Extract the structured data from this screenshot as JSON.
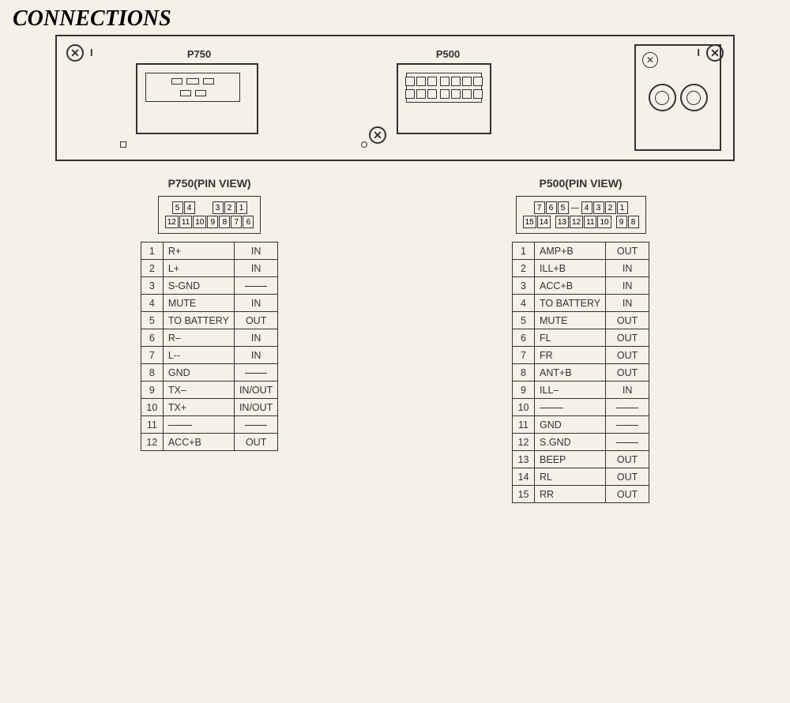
{
  "title": "CONNECTIONS",
  "connectors": {
    "p750": {
      "label": "P750",
      "pinView": {
        "title": "P750(PIN VIEW)",
        "row1": [
          "5",
          "4",
          "",
          "3",
          "2",
          "1"
        ],
        "row2": [
          "12",
          "11",
          "10",
          "9",
          "8",
          "7",
          "6"
        ]
      },
      "pins": [
        {
          "num": "1",
          "name": "R+",
          "dir": "IN"
        },
        {
          "num": "2",
          "name": "L+",
          "dir": "IN"
        },
        {
          "num": "3",
          "name": "S-GND",
          "dir": "—"
        },
        {
          "num": "4",
          "name": "MUTE",
          "dir": "IN"
        },
        {
          "num": "5",
          "name": "TO BATTERY",
          "dir": "OUT"
        },
        {
          "num": "6",
          "name": "R–",
          "dir": "IN"
        },
        {
          "num": "7",
          "name": "L--",
          "dir": "IN"
        },
        {
          "num": "8",
          "name": "GND",
          "dir": "—"
        },
        {
          "num": "9",
          "name": "TX–",
          "dir": "IN/OUT"
        },
        {
          "num": "10",
          "name": "TX+",
          "dir": "IN/OUT"
        },
        {
          "num": "11",
          "name": "—",
          "dir": "—"
        },
        {
          "num": "12",
          "name": "ACC+B",
          "dir": "OUT"
        }
      ]
    },
    "p500": {
      "label": "P500",
      "pinView": {
        "title": "P500(PIN VIEW)",
        "row1": [
          "7",
          "6",
          "5",
          "",
          "4",
          "3",
          "2",
          "1"
        ],
        "row2": [
          "15",
          "14",
          "",
          "13",
          "12",
          "11",
          "10",
          "",
          "9",
          "8"
        ]
      },
      "pins": [
        {
          "num": "1",
          "name": "AMP+B",
          "dir": "OUT"
        },
        {
          "num": "2",
          "name": "ILL+B",
          "dir": "IN"
        },
        {
          "num": "3",
          "name": "ACC+B",
          "dir": "IN"
        },
        {
          "num": "4",
          "name": "TO BATTERY",
          "dir": "IN"
        },
        {
          "num": "5",
          "name": "MUTE",
          "dir": "OUT"
        },
        {
          "num": "6",
          "name": "FL",
          "dir": "OUT"
        },
        {
          "num": "7",
          "name": "FR",
          "dir": "OUT"
        },
        {
          "num": "8",
          "name": "ANT+B",
          "dir": "OUT"
        },
        {
          "num": "9",
          "name": "ILL–",
          "dir": "IN"
        },
        {
          "num": "10",
          "name": "—",
          "dir": "—"
        },
        {
          "num": "11",
          "name": "GND",
          "dir": "—"
        },
        {
          "num": "12",
          "name": "S.GND",
          "dir": "—"
        },
        {
          "num": "13",
          "name": "BEEP",
          "dir": "OUT"
        },
        {
          "num": "14",
          "name": "RL",
          "dir": "OUT"
        },
        {
          "num": "15",
          "name": "RR",
          "dir": "OUT"
        }
      ]
    }
  }
}
